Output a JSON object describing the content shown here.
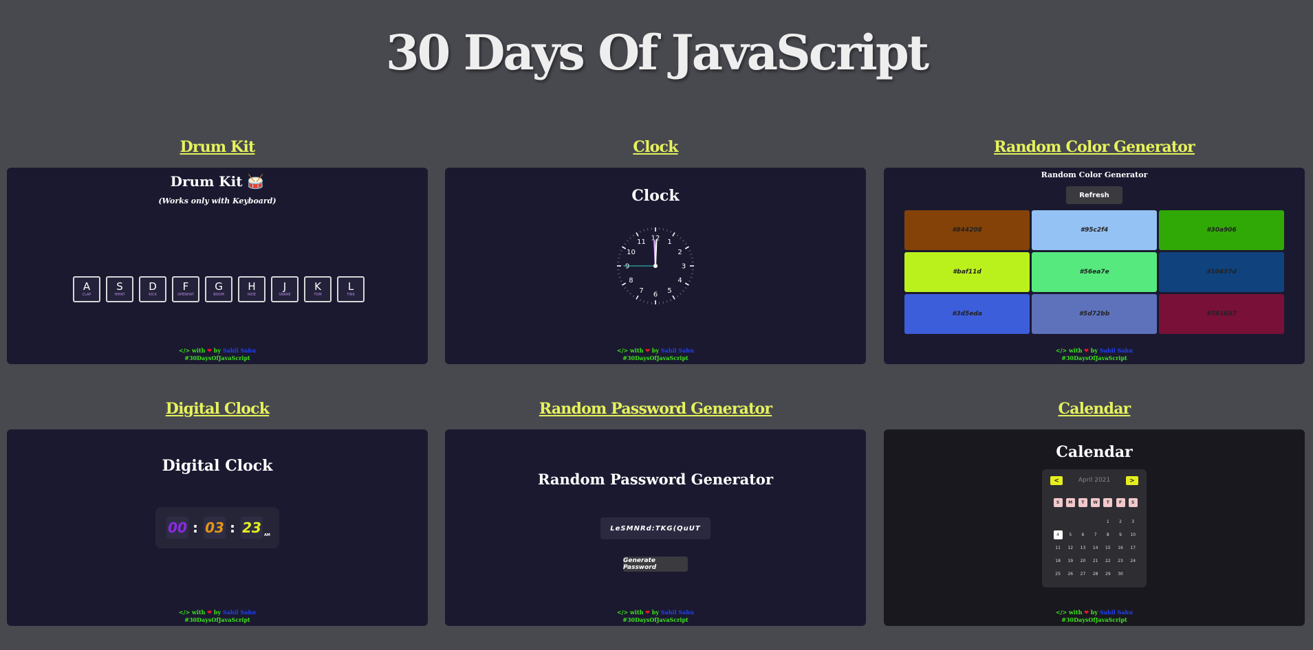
{
  "page": {
    "title": "30 Days Of JavaScript"
  },
  "colors": {
    "background": "#48494f",
    "card": "#1b1930",
    "link": "#e6f35c",
    "accent_yellow": "#e6ef1e"
  },
  "footer": {
    "code": "</>",
    "with": "with",
    "heart": "❤",
    "by": "by",
    "author": "Sahil Sahu",
    "hashtag": "#30DaysOfJavaScript"
  },
  "projects": [
    {
      "link": "Drum Kit",
      "heading": "Drum Kit 🥁",
      "subheading": "(Works only with Keyboard)",
      "keys": [
        {
          "key": "A",
          "sound": "CLAP"
        },
        {
          "key": "S",
          "sound": "HIHAT"
        },
        {
          "key": "D",
          "sound": "KICK"
        },
        {
          "key": "F",
          "sound": "OPENHAT"
        },
        {
          "key": "G",
          "sound": "BOOM"
        },
        {
          "key": "H",
          "sound": "RIDE"
        },
        {
          "key": "J",
          "sound": "SNARE"
        },
        {
          "key": "K",
          "sound": "TOM"
        },
        {
          "key": "L",
          "sound": "TINK"
        }
      ]
    },
    {
      "link": "Clock",
      "heading": "Clock",
      "numbers": [
        "12",
        "1",
        "2",
        "3",
        "4",
        "5",
        "6",
        "7",
        "8",
        "9",
        "10",
        "11"
      ]
    },
    {
      "link": "Random Color Generator",
      "heading": "Random Color Generator",
      "button": "Refresh",
      "swatches": [
        {
          "label": "#844208",
          "color": "#844208"
        },
        {
          "label": "#95c2f4",
          "color": "#95c2f4"
        },
        {
          "label": "#30a906",
          "color": "#30a906"
        },
        {
          "label": "#baf11d",
          "color": "#baf11d"
        },
        {
          "label": "#56ea7e",
          "color": "#56ea7e"
        },
        {
          "label": "#10437d",
          "color": "#10437d"
        },
        {
          "label": "#3d5eda",
          "color": "#3d5eda"
        },
        {
          "label": "#5d72bb",
          "color": "#5d72bb"
        },
        {
          "label": "#781037",
          "color": "#781037"
        }
      ]
    },
    {
      "link": "Digital Clock",
      "heading": "Digital Clock",
      "hours": "00",
      "minutes": "03",
      "seconds": "23",
      "ampm": "AM",
      "hour_color": "#8a2be2",
      "minute_color": "#e59515",
      "second_color": "#e6f01e"
    },
    {
      "link": "Random Password Generator",
      "heading": "Random Password Generator",
      "password": "LeSMNRd:TKG(QuUT",
      "button": "Generate Password"
    },
    {
      "link": "Calendar",
      "heading": "Calendar",
      "month": "April 2021",
      "prev": "<",
      "next": ">",
      "weekdays": [
        "S",
        "M",
        "T",
        "W",
        "T",
        "F",
        "S"
      ],
      "dates": [
        "",
        "",
        "",
        "",
        "1",
        "2",
        "3",
        "4",
        "5",
        "6",
        "7",
        "8",
        "9",
        "10",
        "11",
        "12",
        "13",
        "14",
        "15",
        "16",
        "17",
        "18",
        "19",
        "20",
        "21",
        "22",
        "23",
        "24",
        "25",
        "26",
        "27",
        "28",
        "29",
        "30"
      ],
      "today": "4"
    }
  ]
}
